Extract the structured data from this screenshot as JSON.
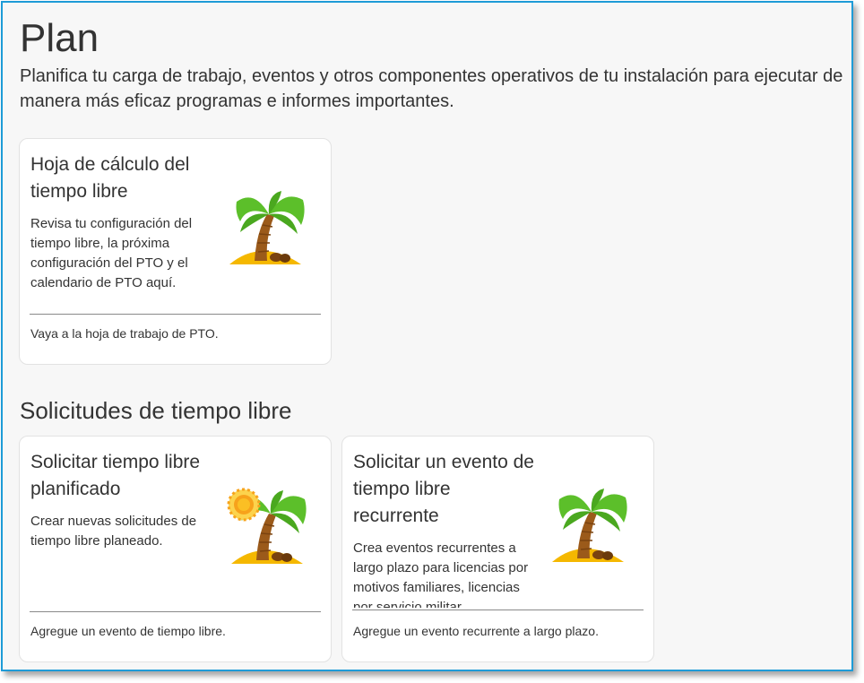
{
  "header": {
    "title": "Plan",
    "description": "Planifica tu carga de trabajo, eventos y otros componentes operativos de tu instalación para ejecutar de manera más eficaz programas e informes importantes."
  },
  "cards_top": [
    {
      "title": "Hoja de cálculo del tiempo libre",
      "text": "Revisa tu configuración del tiempo libre, la próxima configuración del PTO y el calendario de PTO aquí.",
      "link": "Vaya a la hoja de trabajo de PTO.",
      "icon": "palm-tree-icon"
    }
  ],
  "section": {
    "title": "Solicitudes de tiempo libre"
  },
  "cards_requests": [
    {
      "title": "Solicitar tiempo libre planificado",
      "text": "Crear nuevas solicitudes de tiempo libre planeado.",
      "link": "Agregue un evento de tiempo libre.",
      "icon": "palm-tree-sun-icon"
    },
    {
      "title": "Solicitar un evento de tiempo libre recurrente",
      "text": "Crea eventos recurrentes a largo plazo para licencias por motivos familiares, licencias por servicio militar",
      "link": "Agregue un evento recurrente a largo plazo.",
      "icon": "palm-tree-icon"
    }
  ],
  "colors": {
    "frame_border": "#1e9bd7",
    "background": "#f7f7f7",
    "card_background": "#ffffff",
    "palm_leaf": "#5cbf2a",
    "trunk": "#9b5a1a",
    "sand": "#f5b800",
    "sun": "#f7a21b"
  }
}
